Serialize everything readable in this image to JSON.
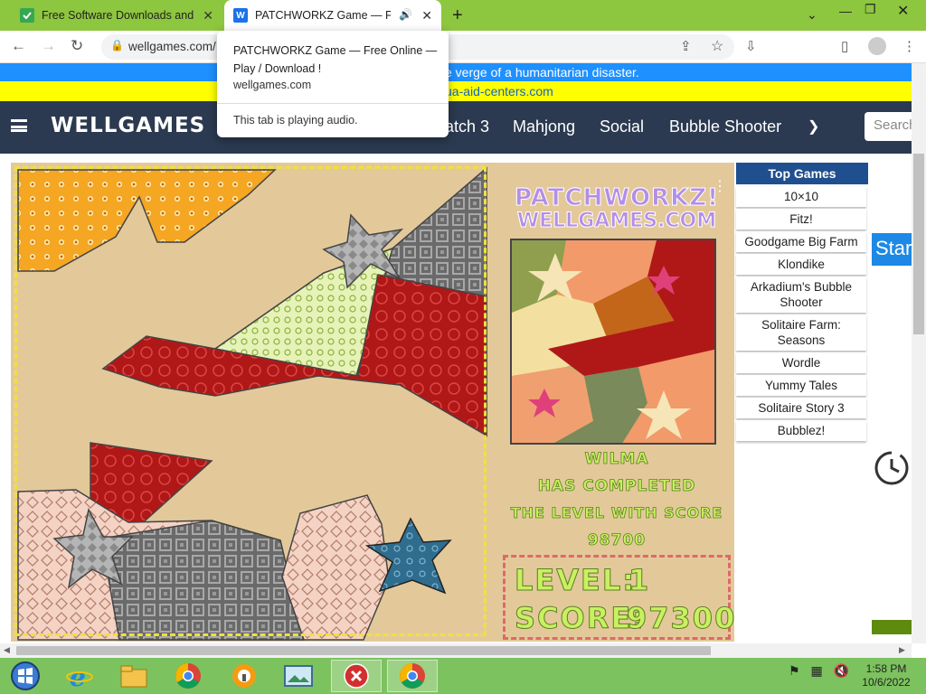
{
  "browser": {
    "tabs": [
      {
        "title": "Free Software Downloads and Re",
        "favicon_color": "#34a853"
      },
      {
        "title": "PATCHWORKZ Game — Free",
        "favicon_color": "#1a73e8"
      }
    ],
    "url": "wellgames.com/",
    "popup": {
      "title": "PATCHWORKZ Game — Free Online — Play / Download !",
      "domain": "wellgames.com",
      "audio_note": "This tab is playing audio."
    }
  },
  "banners": {
    "line1": "e verge of a humanitarian disaster.",
    "line2": "ua-aid-centers.com"
  },
  "site": {
    "logo": "WELLGAMES",
    "nav": [
      "atch 3",
      "Mahjong",
      "Social",
      "Bubble Shooter"
    ],
    "search_placeholder": "Search"
  },
  "game": {
    "title_line1": "PATCHWORKZ!",
    "title_line2": "WELLGAMES.COM",
    "player": "WILMA",
    "message_line1": "HAS COMPLETED",
    "message_line2": "THE LEVEL WITH SCORE",
    "completed_score": "98700",
    "level_label": "LEVEL:",
    "level": "1",
    "score_label": "SCORE:",
    "score": "97300"
  },
  "top_games": {
    "header": "Top Games",
    "items": [
      "10×10",
      "Fitz!",
      "Goodgame Big Farm",
      "Klondike",
      "Arkadium's Bubble Shooter",
      "Solitaire Farm: Seasons",
      "Wordle",
      "Yummy Tales",
      "Solitaire Story 3",
      "Bubblez!"
    ]
  },
  "sidebar": {
    "start_label": "Star"
  },
  "taskbar": {
    "time": "1:58 PM",
    "date": "10/6/2022"
  },
  "colors": {
    "tab_bar": "#8dc63f",
    "nav_bg": "#2b3a50",
    "taskbar": "#7cc25e",
    "top_games_header": "#1f4f8f"
  }
}
